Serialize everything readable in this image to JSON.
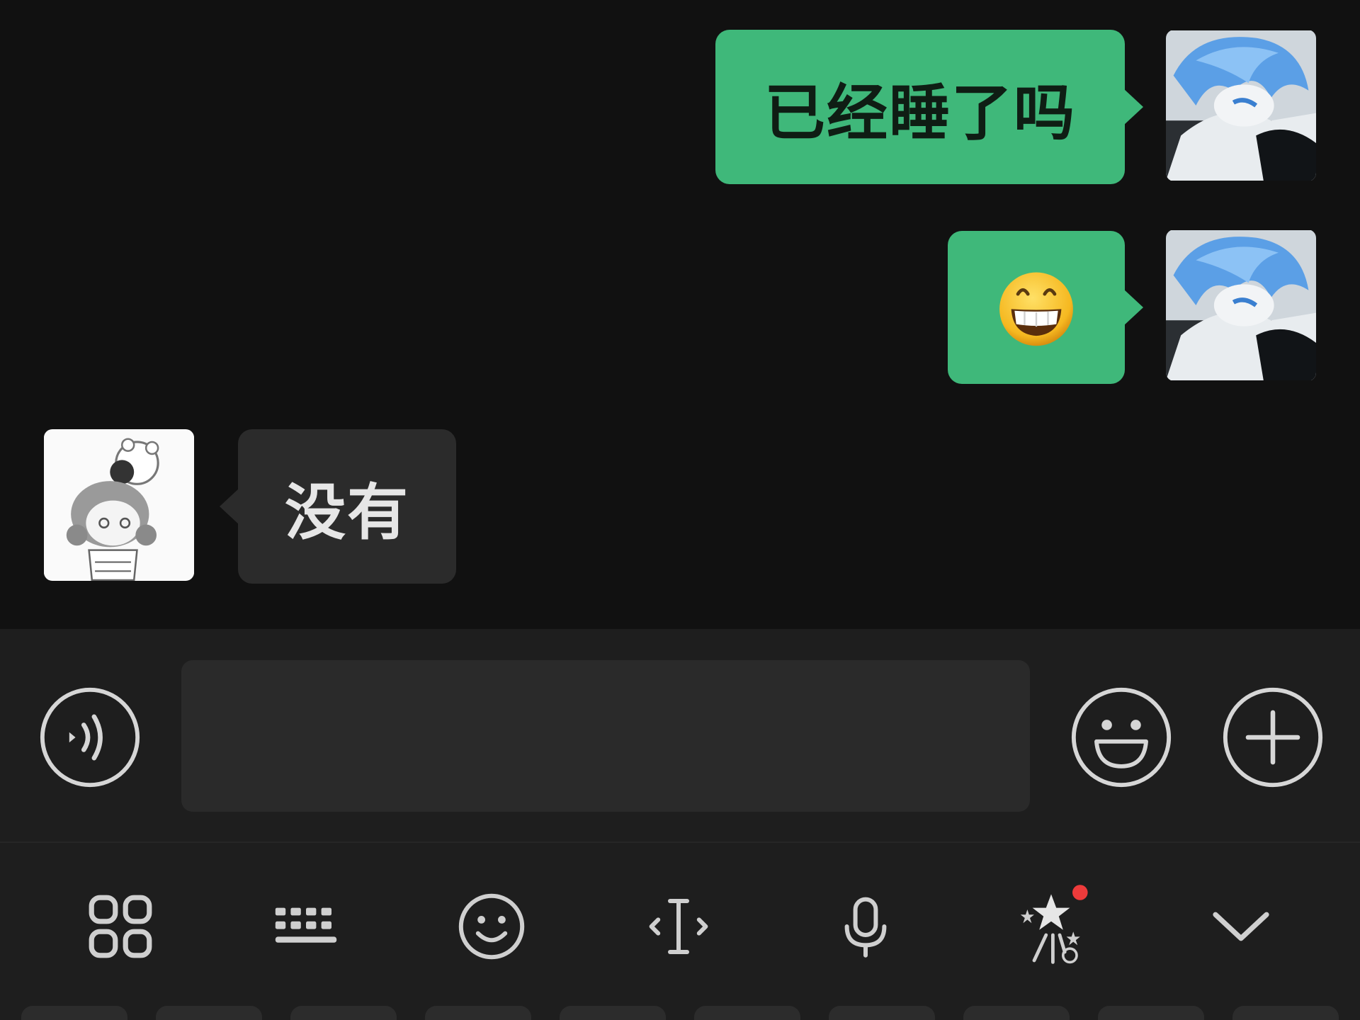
{
  "messages": [
    {
      "direction": "outgoing",
      "type": "text",
      "text": "已经睡了吗"
    },
    {
      "direction": "outgoing",
      "type": "emoji",
      "emoji": "grinning-face-emoji"
    },
    {
      "direction": "incoming",
      "type": "text",
      "text": "没有"
    }
  ],
  "input": {
    "value": "",
    "placeholder": ""
  },
  "input_bar_icons": [
    "voice-icon",
    "emoji-icon",
    "plus-icon"
  ],
  "keyboard_toolbar": {
    "icons": [
      "apps-grid-icon",
      "keyboard-icon",
      "smiley-icon",
      "text-cursor-icon",
      "microphone-icon",
      "magic-stars-icon",
      "chevron-down-icon"
    ],
    "has_notification_dot": true
  },
  "colors": {
    "background": "#111111",
    "outgoing_bubble": "#3fb87a",
    "incoming_bubble": "#2b2b2b",
    "bar_background": "#1e1e1e",
    "icon_stroke": "#d6d6d6",
    "notification_dot": "#ee3b3b"
  }
}
